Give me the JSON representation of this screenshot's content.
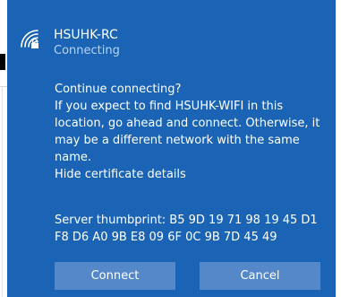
{
  "network": {
    "name": "HSUHK-RC",
    "status": "Connecting",
    "icon": "wifi-secured-icon"
  },
  "prompt": {
    "question": "Continue connecting?",
    "body": "If you expect to find HSUHK-WIFI in this location, go ahead and connect. Otherwise, it may be a different network with the same name.",
    "details_link": "Hide certificate details"
  },
  "certificate": {
    "thumbprint_text": "Server thumbprint: B5 9D 19 71 98 19 45 D1 F8 D6 A0 9B E8 09 6F 0C 9B 7D 45 49"
  },
  "actions": {
    "connect_label": "Connect",
    "cancel_label": "Cancel"
  },
  "colors": {
    "flyout_bg": "#1a63b5",
    "button_bg": "#5588c8",
    "status_text": "#b9d3f0"
  }
}
